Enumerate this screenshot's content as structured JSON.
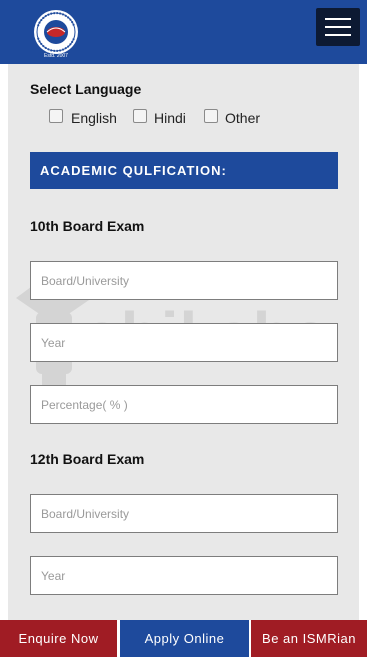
{
  "header": {
    "logo": {
      "icon": "school-seal-logo",
      "caption": "Estd. 2007"
    },
    "menu": {
      "icon": "hamburger-menu-icon"
    }
  },
  "language": {
    "title": "Select Language",
    "options": [
      {
        "label": "English",
        "checked": false
      },
      {
        "label": "Hindi",
        "checked": false
      },
      {
        "label": "Other",
        "checked": false
      }
    ]
  },
  "academic": {
    "banner": "ACADEMIC QULFICATION:",
    "tenth": {
      "title": "10th Board Exam",
      "board_placeholder": "Board/University",
      "year_placeholder": "Year",
      "percentage_placeholder": "Percentage( % )"
    },
    "twelfth": {
      "title": "12th Board Exam",
      "board_placeholder": "Board/University",
      "year_placeholder": "Year"
    }
  },
  "watermark": {
    "text": "shiksha"
  },
  "footer": {
    "enquire": "Enquire Now",
    "apply": "Apply Online",
    "ismrian": "Be an ISMRian"
  },
  "colors": {
    "brand_blue": "#1e4a9c",
    "menu_dark": "#0d1a33",
    "footer_red": "#a01c24",
    "panel_gray": "#e8e8e8"
  }
}
